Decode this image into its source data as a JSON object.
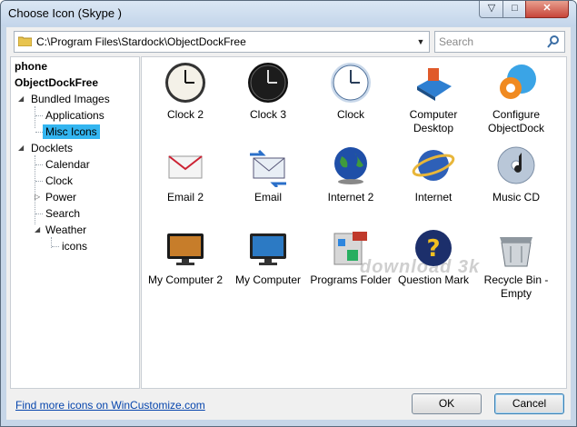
{
  "window": {
    "title": "Choose Icon (Skype )"
  },
  "path": {
    "value": "C:\\Program Files\\Stardock\\ObjectDockFree"
  },
  "search": {
    "placeholder": "Search"
  },
  "tree": {
    "phone": "phone",
    "objectdockfree": "ObjectDockFree",
    "bundled_images": "Bundled Images",
    "applications": "Applications",
    "misc_icons": "Misc Icons",
    "docklets": "Docklets",
    "calendar": "Calendar",
    "clock": "Clock",
    "power": "Power",
    "search": "Search",
    "weather": "Weather",
    "icons": "icons"
  },
  "icons": [
    {
      "label": "Clock 2",
      "icon": "clock-white-icon"
    },
    {
      "label": "Clock 3",
      "icon": "clock-black-icon"
    },
    {
      "label": "Clock",
      "icon": "clock-blue-icon"
    },
    {
      "label": "Computer Desktop",
      "icon": "computer-desktop-icon"
    },
    {
      "label": "Configure ObjectDock",
      "icon": "configure-objectdock-icon"
    },
    {
      "label": "Email 2",
      "icon": "email-envelope-icon"
    },
    {
      "label": "Email",
      "icon": "email-arrows-icon"
    },
    {
      "label": "Internet 2",
      "icon": "globe-icon"
    },
    {
      "label": "Internet",
      "icon": "globe-ring-icon"
    },
    {
      "label": "Music CD",
      "icon": "music-cd-icon"
    },
    {
      "label": "My Computer 2",
      "icon": "monitor-icon"
    },
    {
      "label": "My Computer",
      "icon": "monitor-blue-icon"
    },
    {
      "label": "Programs Folder",
      "icon": "programs-folder-icon"
    },
    {
      "label": "Question Mark",
      "icon": "question-mark-icon"
    },
    {
      "label": "Recycle Bin - Empty",
      "icon": "recycle-bin-icon"
    }
  ],
  "watermark": "download 3k",
  "footer": {
    "link": "Find more icons on WinCustomize.com",
    "ok": "OK",
    "cancel": "Cancel"
  }
}
